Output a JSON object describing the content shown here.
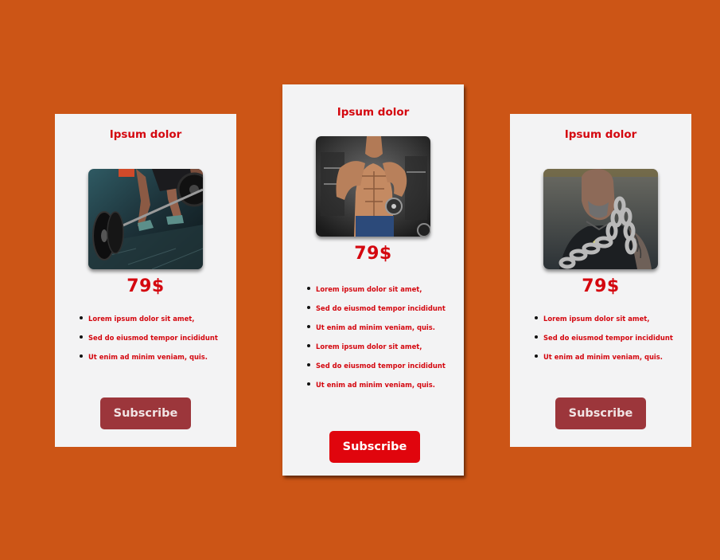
{
  "colors": {
    "background": "#cc5516",
    "card": "#f3f3f4",
    "accent_red": "#d4070f",
    "button_muted": "#9c363b",
    "button_active": "#e0050d"
  },
  "cards": [
    {
      "title": "Ipsum dolor",
      "image": "barbell-deadlift-photo",
      "price": "79$",
      "features": [
        "Lorem ipsum dolor sit amet,",
        "Sed do eiusmod tempor incididunt",
        "Ut enim ad minim veniam, quis."
      ],
      "button": "Subscribe"
    },
    {
      "title": "Ipsum dolor",
      "image": "bodybuilder-dumbbell-photo",
      "price": "79$",
      "features": [
        "Lorem ipsum dolor sit amet,",
        "Sed do eiusmod tempor incididunt",
        "Ut enim ad minim veniam, quis.",
        "Lorem ipsum dolor sit amet,",
        "Sed do eiusmod tempor incididunt",
        "Ut enim ad minim veniam, quis."
      ],
      "button": "Subscribe"
    },
    {
      "title": "Ipsum dolor",
      "image": "man-with-chains-photo",
      "price": "79$",
      "features": [
        "Lorem ipsum dolor sit amet,",
        "Sed do eiusmod tempor incididunt",
        "Ut enim ad minim veniam, quis."
      ],
      "button": "Subscribe"
    }
  ]
}
